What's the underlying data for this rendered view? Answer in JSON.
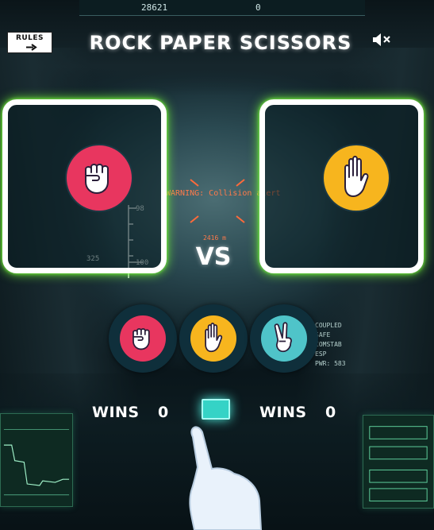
{
  "hud": {
    "top_number_left": "28621",
    "top_number_right": "0",
    "warning": "WARNING: Collision alert",
    "distance": "2416 m",
    "ladder_top": "98",
    "ladder_mid": "325",
    "ladder_bottom": "100",
    "systems": [
      "COUPLED",
      "SAFE",
      "COMSTAB",
      "ESP",
      "PWR: 583"
    ]
  },
  "header": {
    "rules_label": "RULES",
    "title": "ROCK PAPER SCISSORS",
    "mute_icon": "speaker-muted-icon"
  },
  "arena": {
    "player_pick": "rock",
    "house_pick": "paper",
    "vs_label": "VS"
  },
  "choices": [
    {
      "name": "rock",
      "icon": "fist-icon",
      "color": "#e8365f"
    },
    {
      "name": "paper",
      "icon": "open-hand-icon",
      "color": "#f7b51e"
    },
    {
      "name": "scissors",
      "icon": "peace-hand-icon",
      "color": "#4fc4c9"
    }
  ],
  "score": {
    "player_label": "WINS",
    "player_value": "0",
    "house_label": "WINS",
    "house_value": "0"
  },
  "colors": {
    "rock": "#e8365f",
    "paper": "#f7b51e",
    "scissors": "#4fc4c9",
    "card_glow": "#79ff3a",
    "card_border": "#ffffff",
    "warning": "#ff7a4a"
  }
}
